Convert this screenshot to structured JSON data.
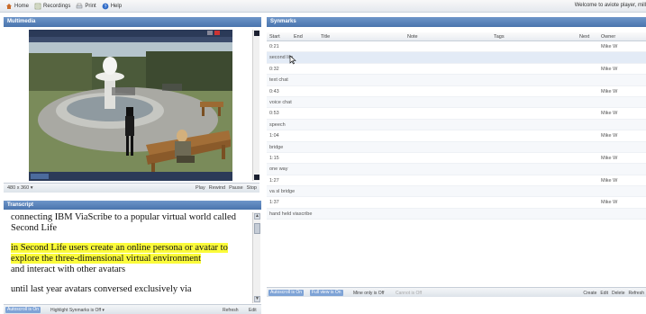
{
  "nav": {
    "home": "Home",
    "recordings": "Recordings",
    "print": "Print",
    "help": "Help",
    "welcome": "Welcome to aviote player, mill"
  },
  "multimedia": {
    "header": "Multimedia",
    "resolution": "480 x 360",
    "resolution_arrow": "▾",
    "controls": [
      "Play",
      "Rewind",
      "Pause",
      "Stop"
    ]
  },
  "transcript": {
    "header": "Transcript",
    "paragraphs": [
      {
        "text": "connecting IBM ViaScribe to a popular virtual world called Second Life",
        "highlight": false
      },
      {
        "text": "in Second Life users create an online persona or avatar to explore the three-dimensional virtual environment",
        "highlight": true
      },
      {
        "text": "and interact with other avatars",
        "highlight": false
      },
      {
        "text": "until last year avatars conversed exclusively via",
        "highlight": false
      }
    ],
    "bottom": {
      "autoscroll": "Autoscroll is On",
      "highlight": "Highlight Synmarks is Off ▾",
      "refresh": "Refresh",
      "edit": "Edit"
    }
  },
  "synmarks": {
    "header": "Synmarks",
    "columns": {
      "start": "Start",
      "end": "End",
      "title": "Title",
      "note": "Note",
      "tags": "Tags",
      "next": "Next",
      "owner": "Owner"
    },
    "rows": [
      {
        "start": "0:21",
        "owner": "Mike W",
        "title": ""
      },
      {
        "start": "",
        "owner": "",
        "title": "second life"
      },
      {
        "start": "0:32",
        "owner": "Mike W",
        "title": ""
      },
      {
        "start": "",
        "owner": "",
        "title": "text chat"
      },
      {
        "start": "0:43",
        "owner": "Mike W",
        "title": ""
      },
      {
        "start": "",
        "owner": "",
        "title": "voice chat"
      },
      {
        "start": "0:53",
        "owner": "Mike W",
        "title": ""
      },
      {
        "start": "",
        "owner": "",
        "title": "speech"
      },
      {
        "start": "1:04",
        "owner": "Mike W",
        "title": ""
      },
      {
        "start": "",
        "owner": "",
        "title": "bridge"
      },
      {
        "start": "1:15",
        "owner": "Mike W",
        "title": ""
      },
      {
        "start": "",
        "owner": "",
        "title": "one way"
      },
      {
        "start": "1:27",
        "owner": "Mike W",
        "title": ""
      },
      {
        "start": "",
        "owner": "",
        "title": "va sl bridge"
      },
      {
        "start": "1:37",
        "owner": "Mike W",
        "title": ""
      },
      {
        "start": "",
        "owner": "",
        "title": "hand held viascribe"
      }
    ],
    "bottom": {
      "autoscroll": "Autoscroll is On",
      "fullview": "Full view is On",
      "mine_only": "Mine only is Off",
      "cannot": "Cannot is Off",
      "actions": [
        "Create",
        "Edit",
        "Delete",
        "Refresh"
      ]
    }
  },
  "colors": {
    "header_blue": "#5780b8",
    "highlight_yellow": "#fbfb3a",
    "pill_blue": "#7ea3d6"
  }
}
